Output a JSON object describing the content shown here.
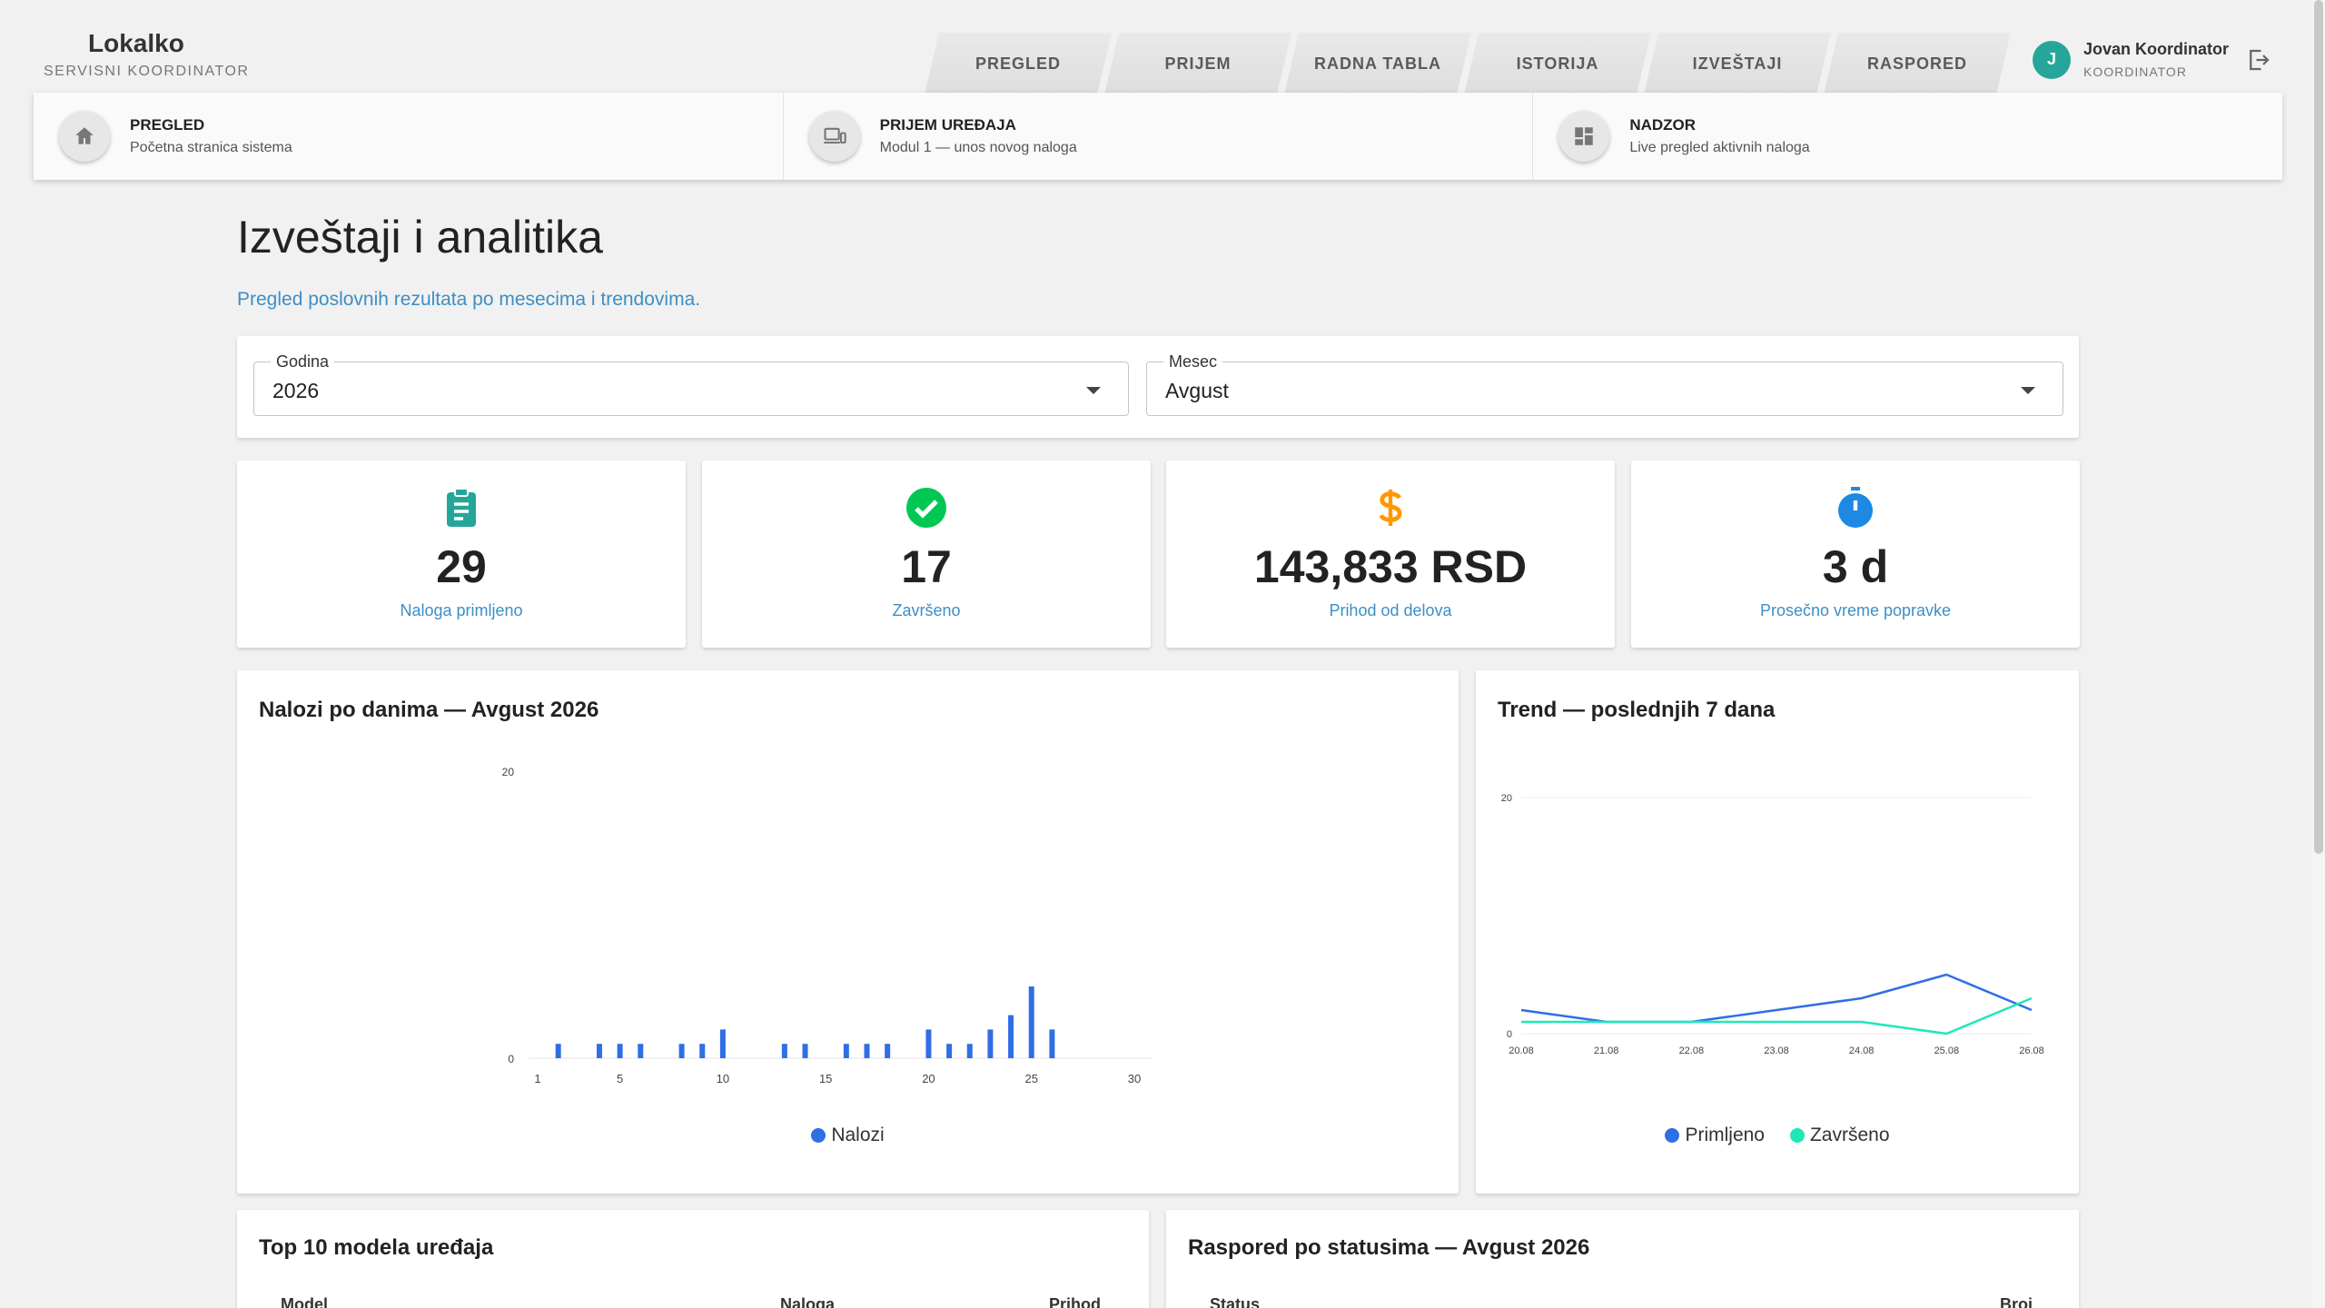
{
  "brand": {
    "name": "Lokalko",
    "subtitle": "SERVISNI KOORDINATOR"
  },
  "nav": {
    "tabs": [
      {
        "label": "PREGLED"
      },
      {
        "label": "PRIJEM"
      },
      {
        "label": "RADNA TABLA"
      },
      {
        "label": "ISTORIJA"
      },
      {
        "label": "IZVEŠTAJI"
      },
      {
        "label": "RASPORED"
      }
    ]
  },
  "user": {
    "initial": "J",
    "name": "Jovan Koordinator",
    "role": "KOORDINATOR",
    "avatar_color": "#26a69a"
  },
  "modules": [
    {
      "title": "PREGLED",
      "subtitle": "Početna stranica sistema",
      "icon": "home-icon"
    },
    {
      "title": "PRIJEM UREĐAJA",
      "subtitle": "Modul 1 — unos novog naloga",
      "icon": "devices-icon"
    },
    {
      "title": "NADZOR",
      "subtitle": "Live pregled aktivnih naloga",
      "icon": "dashboard-icon"
    }
  ],
  "page": {
    "title": "Izveštaji i analitika",
    "subtitle": "Pregled poslovnih rezultata po mesecima i trendovima."
  },
  "filters": {
    "year": {
      "label": "Godina",
      "value": "2026"
    },
    "month": {
      "label": "Mesec",
      "value": "Avgust"
    }
  },
  "kpis": [
    {
      "value": "29",
      "label": "Naloga primljeno",
      "icon": "clipboard-icon",
      "color": "#26a69a"
    },
    {
      "value": "17",
      "label": "Završeno",
      "icon": "check-circle-icon",
      "color": "#00c853"
    },
    {
      "value": "143,833 RSD",
      "label": "Prihod od delova",
      "icon": "dollar-icon",
      "color": "#ff9800"
    },
    {
      "value": "3 d",
      "label": "Prosečno vreme popravke",
      "icon": "timer-icon",
      "color": "#1e88e5"
    }
  ],
  "charts": {
    "daily_title": "Nalozi po danima — Avgust 2026",
    "trend_title": "Trend — poslednjih 7 dana"
  },
  "chart_data": [
    {
      "type": "bar",
      "title": "Nalozi po danima — Avgust 2026",
      "x": [
        1,
        2,
        3,
        4,
        5,
        6,
        7,
        8,
        9,
        10,
        11,
        12,
        13,
        14,
        15,
        16,
        17,
        18,
        19,
        20,
        21,
        22,
        23,
        24,
        25,
        26,
        27,
        28,
        29,
        30
      ],
      "x_ticks": [
        1,
        5,
        10,
        15,
        20,
        25,
        30
      ],
      "ylim": [
        0,
        20
      ],
      "y_ticks": [
        0,
        20
      ],
      "grid": false,
      "legend": "bottom",
      "series": [
        {
          "name": "Nalozi",
          "color": "#2f6fe4",
          "values": [
            0,
            1,
            0,
            1,
            1,
            1,
            0,
            1,
            1,
            2,
            0,
            0,
            1,
            1,
            0,
            1,
            1,
            1,
            0,
            2,
            1,
            1,
            2,
            3,
            5,
            2,
            0,
            0,
            0,
            0
          ]
        }
      ]
    },
    {
      "type": "line",
      "title": "Trend — poslednjih 7 dana",
      "categories": [
        "20.08",
        "21.08",
        "22.08",
        "23.08",
        "24.08",
        "25.08",
        "26.08"
      ],
      "ylim": [
        0,
        20
      ],
      "y_ticks": [
        0,
        20
      ],
      "grid": true,
      "legend": "bottom",
      "series": [
        {
          "name": "Primljeno",
          "color": "#2f6fe4",
          "values": [
            2,
            1,
            1,
            2,
            3,
            5,
            2
          ]
        },
        {
          "name": "Završeno",
          "color": "#1de9b6",
          "values": [
            1,
            1,
            1,
            1,
            1,
            0,
            3
          ]
        }
      ]
    }
  ],
  "bottom": {
    "models_title": "Top 10 modela uređaja",
    "models_cols": [
      "Model",
      "Naloga",
      "Prihod"
    ],
    "status_title": "Raspored po statusima — Avgust 2026",
    "status_cols": [
      "Status",
      "Broj"
    ]
  }
}
